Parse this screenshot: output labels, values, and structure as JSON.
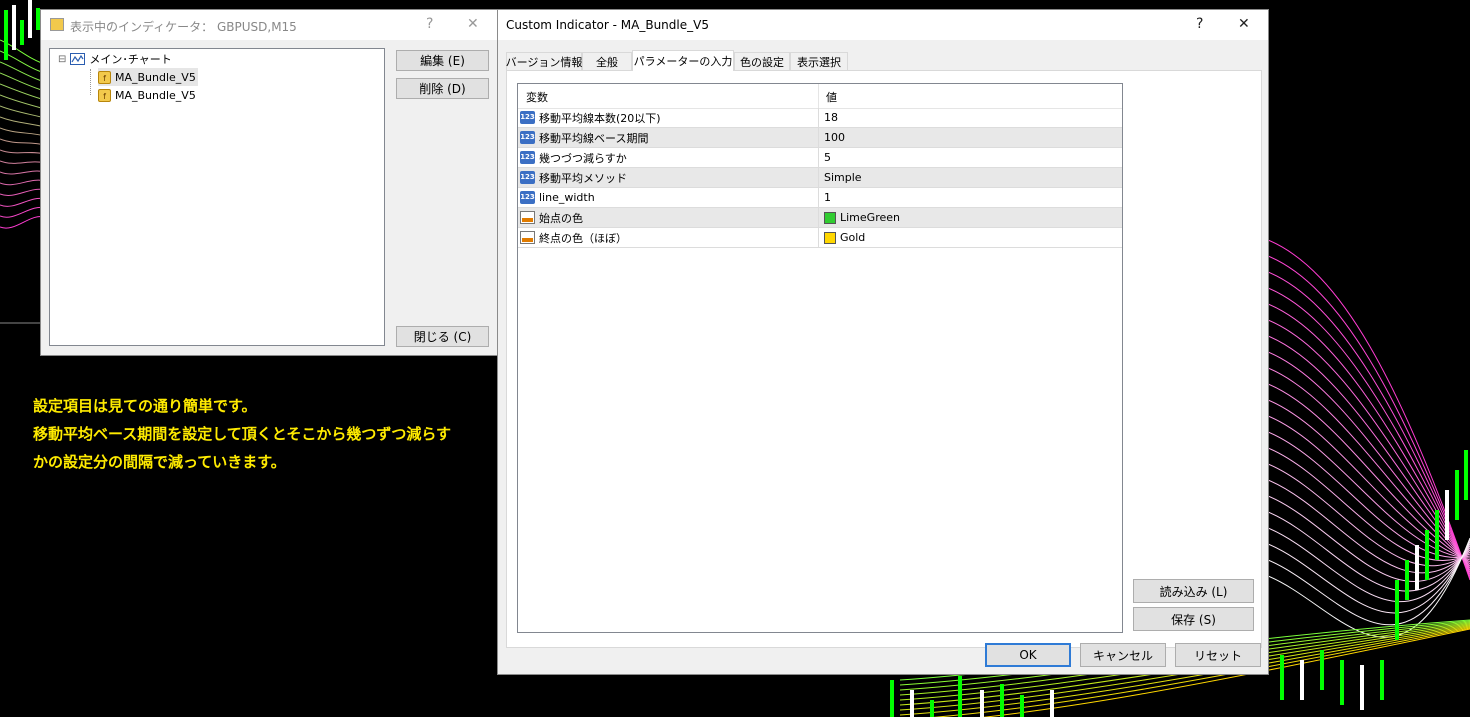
{
  "indicator_list_window": {
    "title": "表示中のインディケータ： GBPUSD,M15",
    "help": "?",
    "close": "✕",
    "tree": {
      "root_label": "メイン･チャート",
      "toggle": "⊟",
      "children": [
        "MA_Bundle_V5",
        "MA_Bundle_V5"
      ]
    },
    "buttons": {
      "edit": "編集 (E)",
      "delete": "削除 (D)",
      "close": "閉じる (C)"
    }
  },
  "custom_indicator_window": {
    "title": "Custom Indicator - MA_Bundle_V5",
    "help": "?",
    "close": "✕",
    "tabs": [
      "バージョン情報",
      "全般",
      "パラメーターの入力",
      "色の設定",
      "表示選択"
    ],
    "active_tab": 2,
    "grid": {
      "col_name": "変数",
      "col_value": "値",
      "rows": [
        {
          "name": "移動平均線本数(20以下)",
          "value": "18",
          "kind": "number"
        },
        {
          "name": "移動平均線ベース期間",
          "value": "100",
          "kind": "number"
        },
        {
          "name": "幾つづつ減らすか",
          "value": "5",
          "kind": "number"
        },
        {
          "name": "移動平均メソッド",
          "value": "Simple",
          "kind": "number"
        },
        {
          "name": "line_width",
          "value": "1",
          "kind": "number"
        },
        {
          "name": "始点の色",
          "value": "LimeGreen",
          "kind": "color",
          "swatch": "#32cd32"
        },
        {
          "name": "終点の色（ほぼ）",
          "value": "Gold",
          "kind": "color",
          "swatch": "#ffd700"
        }
      ]
    },
    "buttons": {
      "load": "読み込み (L)",
      "save": "保存 (S)",
      "ok": "OK",
      "cancel": "キャンセル",
      "reset": "リセット"
    }
  },
  "caption": {
    "lines": [
      "設定項目は見ての通り簡単です。",
      "移動平均ベース期間を設定して頂くとそこから幾つずつ減らす",
      "かの設定分の間隔で減っていきます。"
    ],
    "color": "#ffeb00"
  },
  "colors": {
    "chart_bg": "#000000",
    "bull": "#00ff00",
    "bear": "#ffffff",
    "accent": "#2f7bd6"
  }
}
